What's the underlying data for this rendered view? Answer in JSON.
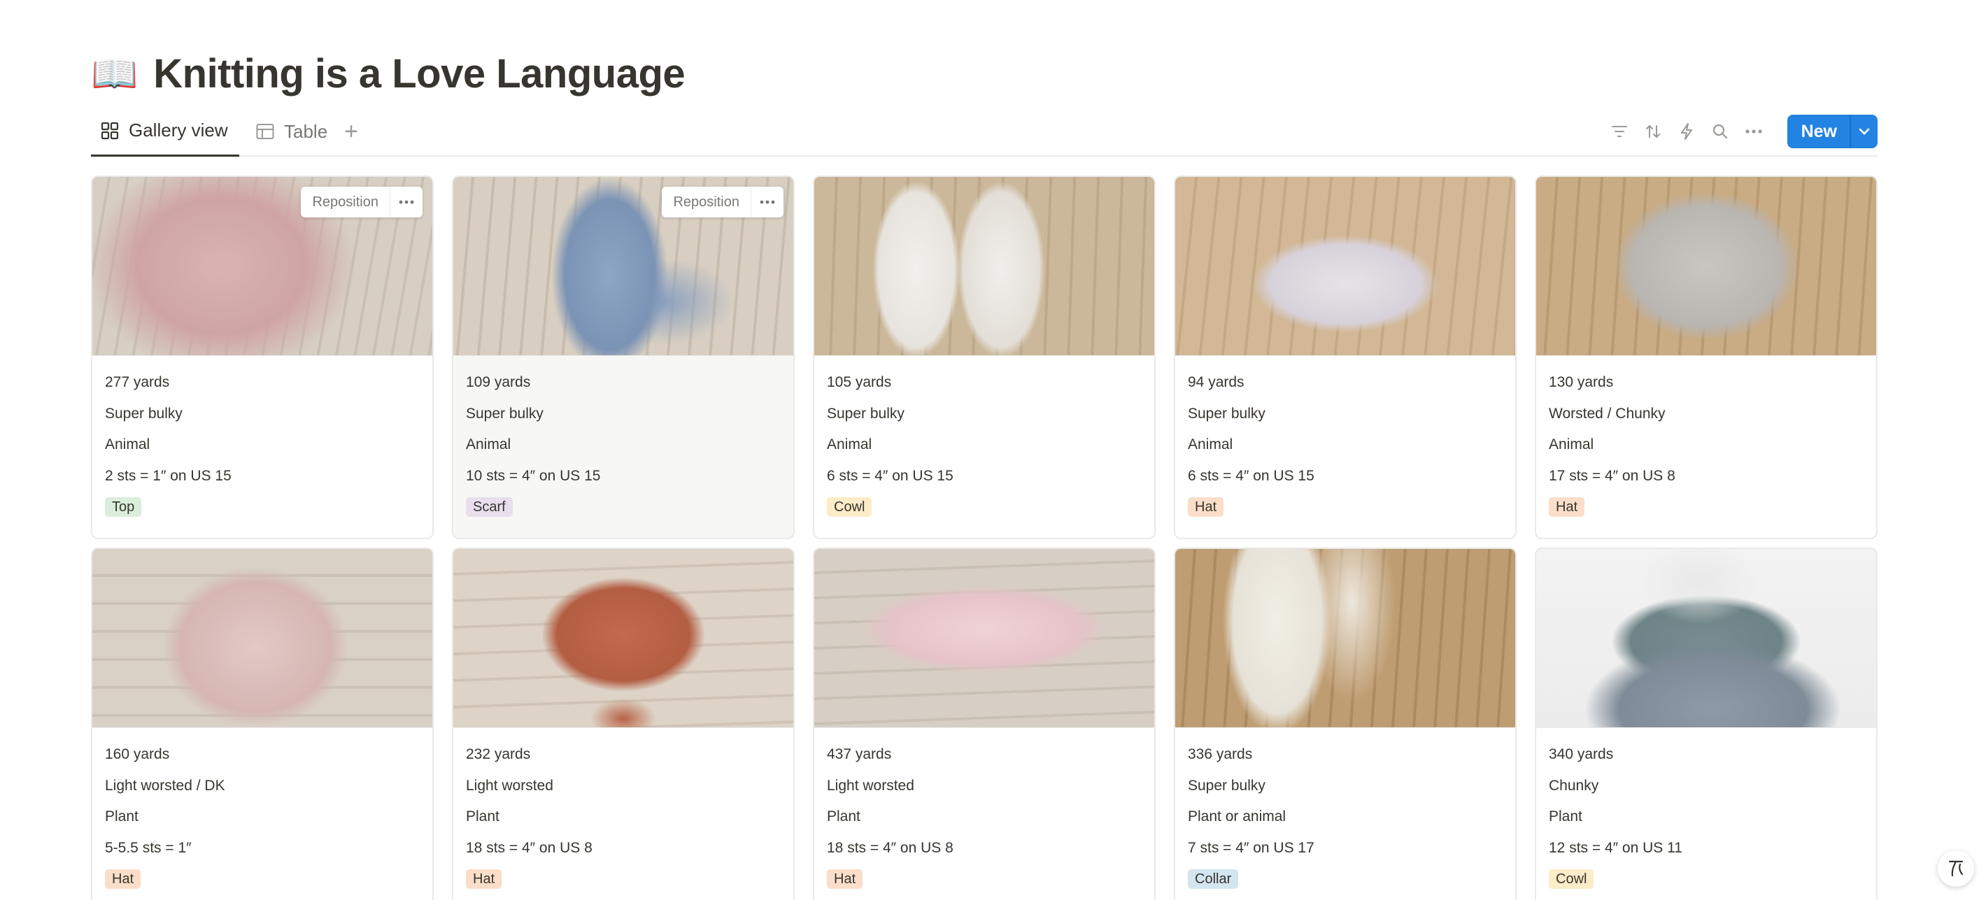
{
  "page": {
    "icon": "📖",
    "title": "Knitting is a Love Language"
  },
  "views": [
    {
      "label": "Gallery view",
      "icon": "gallery-icon",
      "active": true
    },
    {
      "label": "Table",
      "icon": "table-icon",
      "active": false
    }
  ],
  "toolbar": {
    "icons": [
      "filter-icon",
      "sort-icon",
      "automation-icon",
      "search-icon",
      "more-icon"
    ],
    "new_label": "New"
  },
  "card_menu": {
    "reposition_label": "Reposition"
  },
  "colors": {
    "accent": "#2383e2",
    "tag_top": "#dbeddb",
    "tag_scarf": "#e8deee",
    "tag_cowl": "#fdecc8",
    "tag_hat": "#fadec9",
    "tag_collar": "#d3e5ef"
  },
  "cards": [
    {
      "yardage": "277 yards",
      "weight": "Super bulky",
      "fiber": "Animal",
      "gauge": "2 sts = 1″ on US 15",
      "tag": "Top"
    },
    {
      "yardage": "109 yards",
      "weight": "Super bulky",
      "fiber": "Animal",
      "gauge": "10 sts = 4″ on US 15",
      "tag": "Scarf"
    },
    {
      "yardage": "105 yards",
      "weight": "Super bulky",
      "fiber": "Animal",
      "gauge": "6 sts = 4″ on US 15",
      "tag": "Cowl"
    },
    {
      "yardage": "94 yards",
      "weight": "Super bulky",
      "fiber": "Animal",
      "gauge": "6 sts = 4″ on US 15",
      "tag": "Hat"
    },
    {
      "yardage": "130 yards",
      "weight": "Worsted / Chunky",
      "fiber": "Animal",
      "gauge": "17 sts = 4″ on US 8",
      "tag": "Hat"
    },
    {
      "yardage": "160 yards",
      "weight": "Light worsted / DK",
      "fiber": "Plant",
      "gauge": "5-5.5 sts = 1″",
      "tag": "Hat"
    },
    {
      "yardage": "232 yards",
      "weight": "Light worsted",
      "fiber": "Plant",
      "gauge": "18 sts = 4″ on US 8",
      "tag": "Hat"
    },
    {
      "yardage": "437 yards",
      "weight": "Light worsted",
      "fiber": "Plant",
      "gauge": "18 sts = 4″ on US 8",
      "tag": "Hat"
    },
    {
      "yardage": "336 yards",
      "weight": "Super bulky",
      "fiber": "Plant or animal",
      "gauge": "7 sts = 4″ on US 17",
      "tag": "Collar"
    },
    {
      "yardage": "340 yards",
      "weight": "Chunky",
      "fiber": "Plant",
      "gauge": "12 sts = 4″ on US 11",
      "tag": "Cowl"
    }
  ]
}
